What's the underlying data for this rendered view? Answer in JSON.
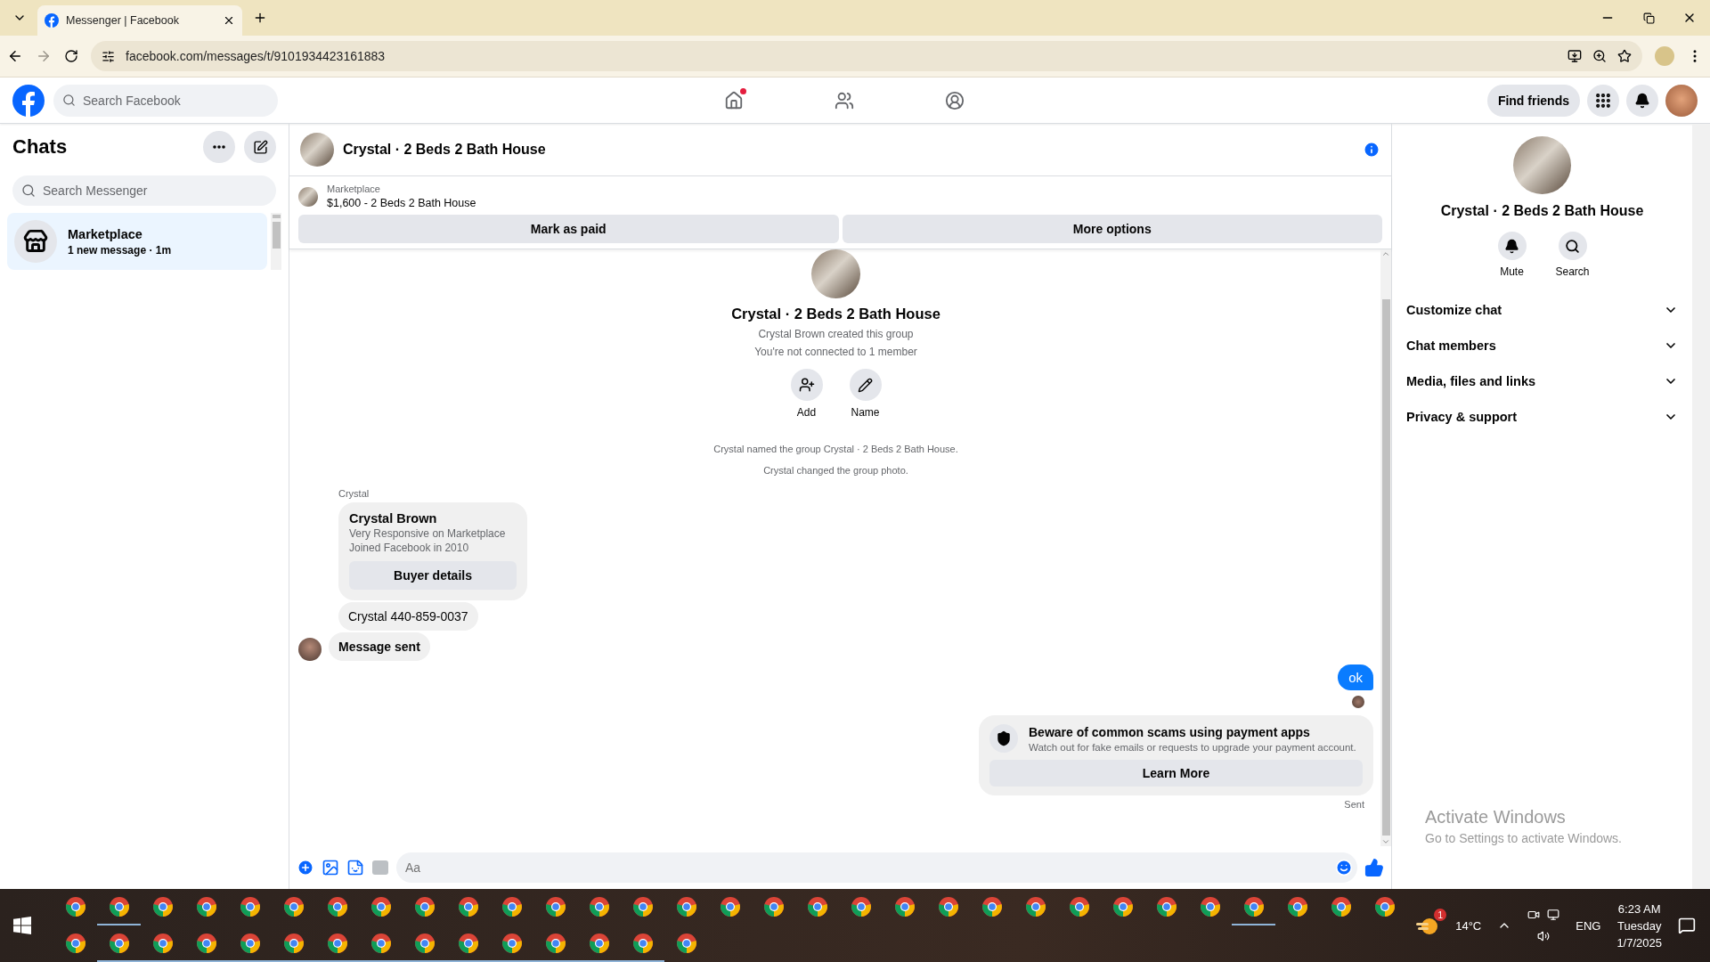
{
  "browser": {
    "tab_title": "Messenger | Facebook",
    "url": "facebook.com/messages/t/9101934423161883"
  },
  "topbar": {
    "search_placeholder": "Search Facebook",
    "nav": [
      {
        "kind": "home",
        "notification_dot": true
      },
      {
        "kind": "friends",
        "notification_dot": false
      },
      {
        "kind": "groups",
        "notification_dot": false
      }
    ],
    "find_friends": "Find friends"
  },
  "sidebar": {
    "title": "Chats",
    "search_placeholder": "Search Messenger",
    "chats": [
      {
        "name": "Marketplace",
        "preview": "1 new message · 1m",
        "selected": true,
        "unread": true
      }
    ]
  },
  "conversation": {
    "title": "Crystal · 2 Beds 2 Bath House",
    "listing": {
      "source": "Marketplace",
      "price_title": "$1,600 - 2 Beds 2 Bath House"
    },
    "actions": [
      "Mark as paid",
      "More options"
    ],
    "intro": {
      "title": "Crystal · 2 Beds 2 Bath House",
      "lines": [
        "Crystal Brown created this group",
        "You're not connected to 1 member"
      ],
      "buttons": [
        {
          "kind": "add",
          "label": "Add"
        },
        {
          "kind": "name",
          "label": "Name"
        }
      ]
    },
    "events": [
      "Crystal named the group Crystal · 2 Beds 2 Bath House.",
      "Crystal changed the group photo."
    ],
    "messages": [
      {
        "kind": "sender",
        "text": "Crystal"
      },
      {
        "kind": "profile_card",
        "name": "Crystal Brown",
        "lines": [
          "Very Responsive on Marketplace",
          "Joined Facebook in 2010"
        ],
        "button": "Buyer details"
      },
      {
        "kind": "incoming",
        "text": "Crystal 440-859-0037",
        "bold": false
      },
      {
        "kind": "incoming",
        "text": "Message sent",
        "bold": true
      },
      {
        "kind": "outgoing",
        "text": "ok",
        "seen": true
      },
      {
        "kind": "safety_notice",
        "title": "Beware of common scams using payment apps",
        "text": "Watch out for fake emails or requests to upgrade your payment account.",
        "button": "Learn More"
      },
      {
        "kind": "status",
        "text": "Sent"
      }
    ],
    "composer": {
      "placeholder": "Aa"
    }
  },
  "details": {
    "title": "Crystal · 2 Beds 2 Bath House",
    "actions": [
      {
        "kind": "mute",
        "label": "Mute"
      },
      {
        "kind": "search",
        "label": "Search"
      }
    ],
    "sections": [
      {
        "label": "Customize chat",
        "expanded": false
      },
      {
        "label": "Chat members",
        "expanded": false
      },
      {
        "label": "Media, files and links",
        "expanded": false
      },
      {
        "label": "Privacy & support",
        "expanded": false
      }
    ]
  },
  "activation": {
    "title": "Activate Windows",
    "text": "Go to Settings to activate Windows."
  },
  "taskbar": {
    "weather_badge": "1",
    "temperature": "14°C",
    "language": "ENG",
    "time": "6:23 AM",
    "day": "Tuesday",
    "date": "1/7/2025"
  }
}
